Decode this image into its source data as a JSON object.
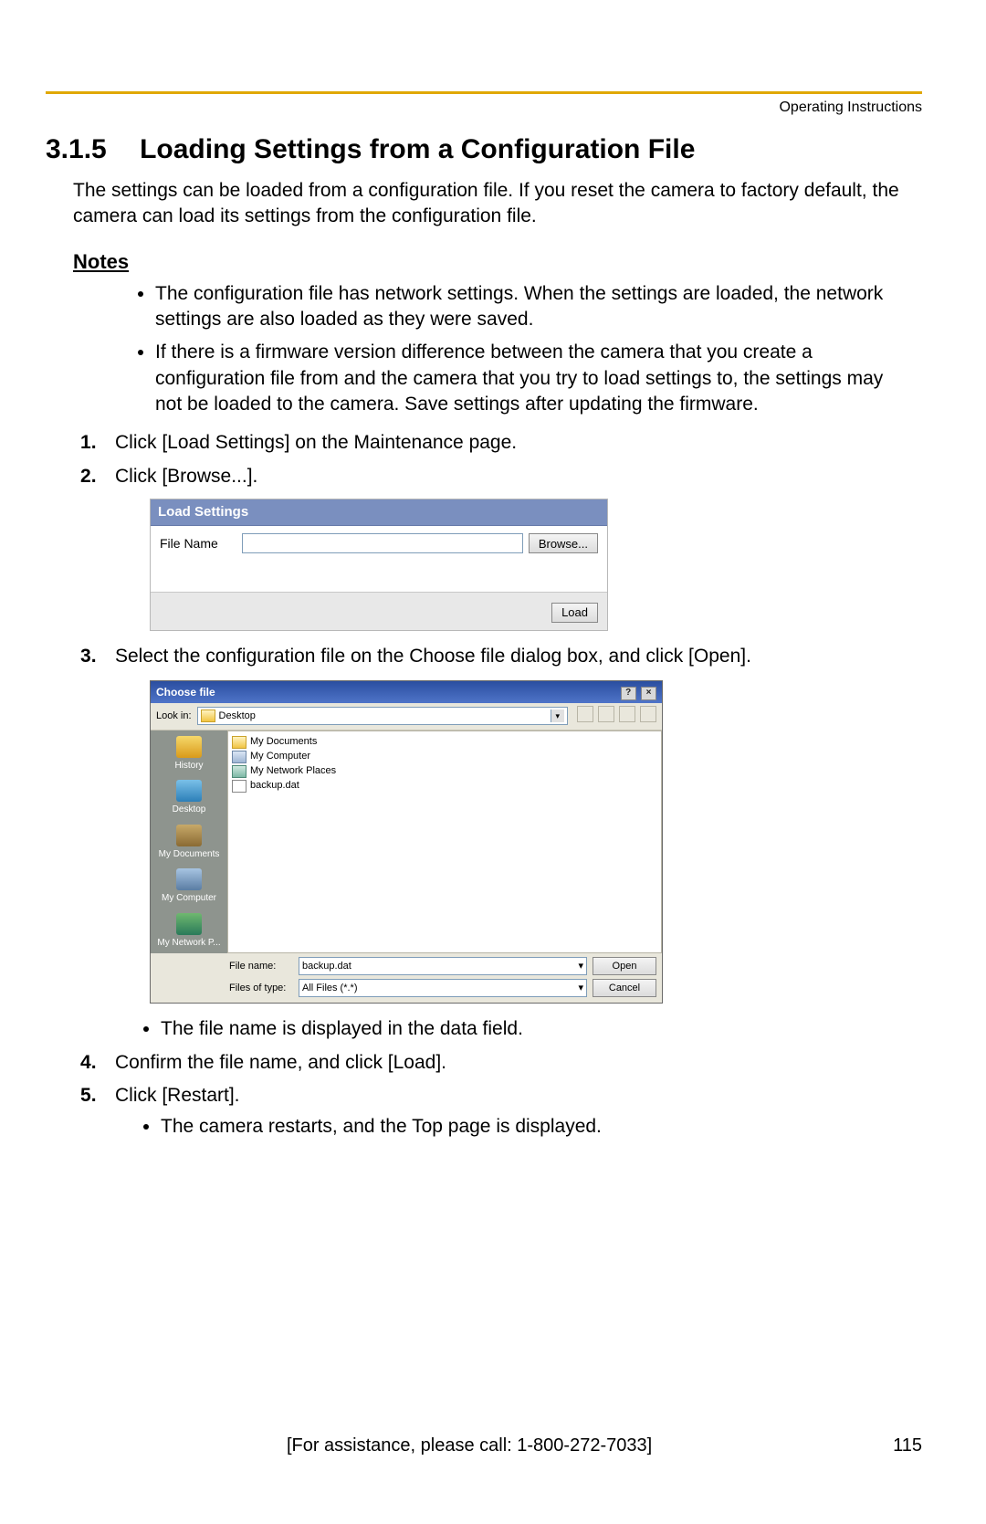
{
  "header": {
    "label": "Operating Instructions"
  },
  "section": {
    "number": "3.1.5",
    "title": "Loading Settings from a Configuration File",
    "intro": "The settings can be loaded from a configuration file. If you reset the camera to factory default, the camera can load its settings from the configuration file."
  },
  "notes": {
    "heading": "Notes",
    "items": [
      "The configuration file has network settings. When the settings are loaded, the network settings are also loaded as they were saved.",
      "If there is a firmware version difference between the camera that you create a configuration file from and the camera that you try to load settings to, the settings may not be loaded to the camera. Save settings after updating the firmware."
    ]
  },
  "steps": {
    "s1": "Click [Load Settings] on the Maintenance page.",
    "s2": "Click [Browse...].",
    "s3": "Select the configuration file on the Choose file dialog box, and click [Open].",
    "s3_sub": "The file name is displayed in the data field.",
    "s4": "Confirm the file name, and click [Load].",
    "s5": "Click [Restart].",
    "s5_sub": "The camera restarts, and the Top page is displayed."
  },
  "load_panel": {
    "title": "Load Settings",
    "file_label": "File Name",
    "file_value": "",
    "browse_label": "Browse...",
    "load_label": "Load"
  },
  "file_dialog": {
    "title": "Choose file",
    "help_glyph": "?",
    "close_glyph": "×",
    "lookin_label": "Look in:",
    "lookin_value": "Desktop",
    "places": {
      "history": "History",
      "desktop": "Desktop",
      "mydocs": "My Documents",
      "mycomp": "My Computer",
      "mynet": "My Network P..."
    },
    "files": {
      "mydocs": "My Documents",
      "mycomp": "My Computer",
      "mynet": "My Network Places",
      "backup": "backup.dat"
    },
    "filename_label": "File name:",
    "filename_value": "backup.dat",
    "filetype_label": "Files of type:",
    "filetype_value": "All Files (*.*)",
    "open_label": "Open",
    "cancel_label": "Cancel"
  },
  "footer": {
    "assist": "[For assistance, please call: 1-800-272-7033]",
    "page_number": "115"
  }
}
